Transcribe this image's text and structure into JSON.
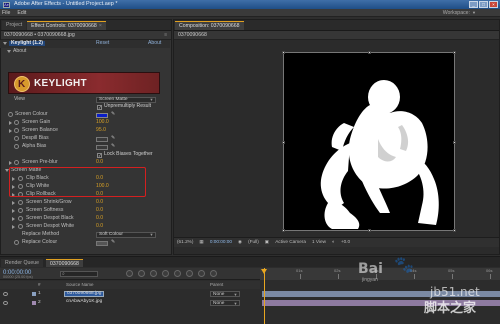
{
  "window": {
    "title": "Adobe After Effects - Untitled Project.aep *",
    "controls": [
      "_",
      "□",
      "×"
    ]
  },
  "menu": {
    "items": [
      "File",
      "Edit"
    ],
    "workspace_label": "Workspace:"
  },
  "left_panel": {
    "tabs": [
      {
        "label": "Project"
      },
      {
        "label": "Effect Controls: 0370090668",
        "close": "×"
      }
    ],
    "header": "0370090668 • 0370090668.jpg",
    "header_menu": "≡",
    "effect_name": "Keylight (1.2)",
    "effect_reset": "Reset",
    "effect_about_link": "About",
    "about_label": "About",
    "logo_text": "KEYLIGHT",
    "params": [
      {
        "label": "View",
        "value": "Screen Matte",
        "kind": "dropdown"
      },
      {
        "label": "",
        "value": "Unpremultiply Result",
        "kind": "checkbox",
        "checked": true
      },
      {
        "label": "Screen Colour",
        "value": "",
        "kind": "color"
      },
      {
        "label": "Screen Gain",
        "value": "100.0",
        "kind": "number"
      },
      {
        "label": "Screen Balance",
        "value": "95.0",
        "kind": "number"
      },
      {
        "label": "Despill Bias",
        "value": "",
        "kind": "color2"
      },
      {
        "label": "Alpha Bias",
        "value": "",
        "kind": "color2"
      },
      {
        "label": "",
        "value": "Lock Biases Together",
        "kind": "checkbox",
        "checked": true
      },
      {
        "label": "Screen Pre-blur",
        "value": "0.0",
        "kind": "number"
      },
      {
        "label": "Screen Matte",
        "value": "",
        "kind": "group"
      },
      {
        "label": "Clip Black",
        "value": "0.0",
        "kind": "number"
      },
      {
        "label": "Clip White",
        "value": "100.0",
        "kind": "number"
      },
      {
        "label": "Clip Rollback",
        "value": "0.0",
        "kind": "number"
      },
      {
        "label": "Screen Shrink/Grow",
        "value": "0.0",
        "kind": "number"
      },
      {
        "label": "Screen Softness",
        "value": "0.0",
        "kind": "number"
      },
      {
        "label": "Screen Despot Black",
        "value": "0.0",
        "kind": "number"
      },
      {
        "label": "Screen Despot White",
        "value": "0.0",
        "kind": "number"
      },
      {
        "label": "Replace Method",
        "value": "Soft Colour",
        "kind": "dropdown"
      },
      {
        "label": "Replace Colour",
        "value": "",
        "kind": "color"
      }
    ]
  },
  "composition": {
    "tab_label": "Composition: 0370090668",
    "header": "0370090668",
    "footer": {
      "zoom": "(61.2%)",
      "timecode": "0:00:00:00",
      "resolution": "(Full)",
      "camera": "Active Camera",
      "view": "1 View",
      "offset": "+0.0"
    }
  },
  "timeline": {
    "tabs": [
      "Render Queue",
      "0370090668"
    ],
    "timecode": "0:00:00:00",
    "timecode_sub": "00000 (25.00 fps)",
    "ruler_labels": [
      "01s",
      "02s",
      "03s",
      "04s",
      "05s",
      "06s"
    ],
    "columns": {
      "num": "#",
      "name": "Source Name",
      "parent": "Parent"
    },
    "layers": [
      {
        "num": "1",
        "name": "0370090668.jpg",
        "parent": "None",
        "selected": true,
        "color": "#8aa0c0"
      },
      {
        "num": "2",
        "name": "cnAbwAby1K.jpg",
        "parent": "None",
        "selected": false,
        "color": "#a08ab0"
      }
    ]
  },
  "watermarks": {
    "baidu": "Bai",
    "baidu_sub": "jingyan",
    "site": "jb51.net",
    "site_cn": "脚本之家"
  },
  "colors": {
    "accent": "#e8a620",
    "value_orange": "#d7a026",
    "highlight_red": "#d42020",
    "screen_colour": "#0a1ec8"
  }
}
